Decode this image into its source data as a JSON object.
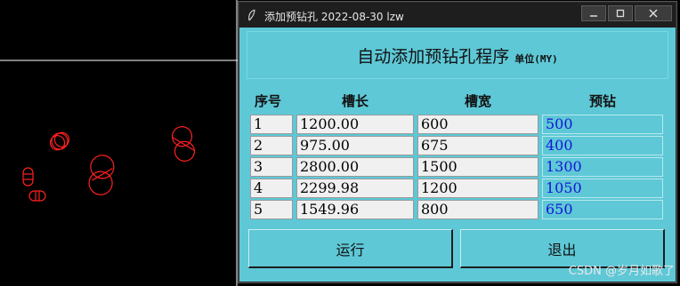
{
  "window": {
    "title": "添加预钻孔   2022-08-30 lzw",
    "header_title": "自动添加预钻孔程序",
    "header_unit": "单位(MY)"
  },
  "table": {
    "columns": [
      "序号",
      "槽长",
      "槽宽",
      "预钻"
    ],
    "rows": [
      {
        "index": "1",
        "length": "1200.00",
        "width": "600",
        "drill": "500"
      },
      {
        "index": "2",
        "length": "975.00",
        "width": "675",
        "drill": "400"
      },
      {
        "index": "3",
        "length": "2800.00",
        "width": "1500",
        "drill": "1300"
      },
      {
        "index": "4",
        "length": "2299.98",
        "width": "1200",
        "drill": "1050"
      },
      {
        "index": "5",
        "length": "1549.96",
        "width": "800",
        "drill": "650"
      }
    ]
  },
  "buttons": {
    "run": "运行",
    "exit": "退出"
  },
  "watermark": "CSDN @岁月如歌了",
  "colors": {
    "dialog_bg": "#5ec8d6",
    "drill_text": "#1515d8",
    "cad_shapes": "#ff0000",
    "titlebar": "#1e1e1e"
  },
  "icons": [
    "feather-icon",
    "minimize-icon",
    "maximize-icon",
    "close-icon"
  ]
}
